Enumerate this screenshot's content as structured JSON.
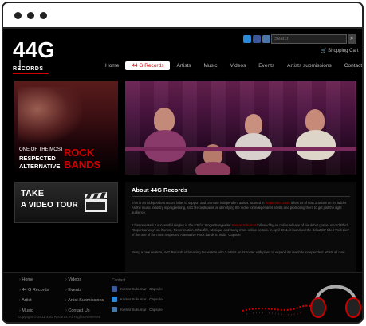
{
  "brand": {
    "logo_text": "44G",
    "logo_sub": "RECORDS"
  },
  "colors": {
    "accent": "#cc0000",
    "background": "#000000",
    "nav_active_bg": "#ffffff"
  },
  "header": {
    "social_icons": [
      "twitter-icon",
      "facebook-icon",
      "vk-icon"
    ],
    "search_placeholder": "Search",
    "search_button": "»",
    "cart_label": "Shopping Cart"
  },
  "nav": {
    "items": [
      "Home",
      "44 G Records",
      "Artists",
      "Music",
      "Videos",
      "Events",
      "Artists submissions",
      "Contact Us"
    ],
    "active_index": 1
  },
  "promo": {
    "line1": "ONE OF THE MOST",
    "line2": "RESPECTED",
    "line3": "ALTERNATIVE",
    "highlight1": "ROCK",
    "highlight2": "BANDS"
  },
  "tour": {
    "line1": "TAKE",
    "line2": "A VIDEO TOUR"
  },
  "about": {
    "title": "About 44G Records",
    "p1_before": "This is an independent record label to support and promote independent artists. Started in ",
    "p1_red": "September 2009",
    "p1_after": " it has as of now 2 artists on it's ladder. As the music industry is progressing, 44G Records aims at identifying the niche for independent artists and promoting them to get just the right audience.",
    "p2_before": "It has released 2 successful singles in the US for Singer/Songwriter ",
    "p2_red": "Kumar Sukumar",
    "p2_after": " followed by an online release of his debut gospel record titled \"Superstar way\" on iTunes , Reverbnation, Shoutfile, Musique and many more online portals. In April 2011, it launched the debut EP titled 'Red Lies' of the one of the most respected Alternative Rock bands in India \"Capsule\".",
    "p3": "Being a new venture, 44G Records is breaking the waters with 2 artists on its roster with plans to expand it's reach to independent artists all over."
  },
  "footer": {
    "col1": [
      "Home",
      "44 G Records",
      "Artist",
      "Music"
    ],
    "col2": [
      "Videos",
      "Events",
      "Artist Submissions",
      "Contact Us"
    ],
    "contact_heading": "Contact",
    "contacts": [
      {
        "icon": "facebook-icon",
        "text": "Kumar Sukumar | Capsule"
      },
      {
        "icon": "twitter-icon",
        "text": "Kumar Sukumar | Capsule"
      },
      {
        "icon": "vk-icon",
        "text": "Kumar Sukumar | Capsule"
      }
    ],
    "copyright": "Copyright © 2011 44G Records. All Rights Reserved"
  }
}
